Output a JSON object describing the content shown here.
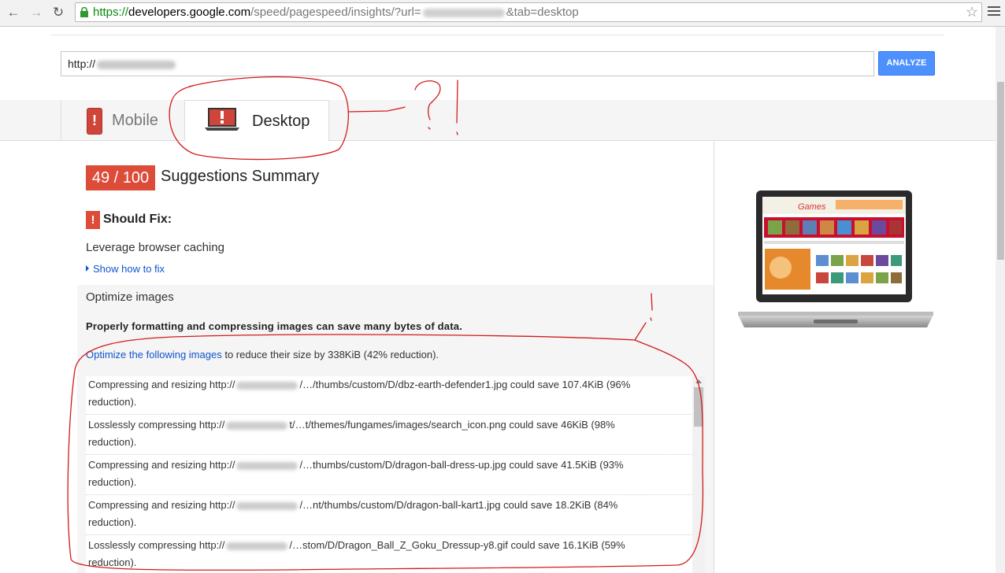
{
  "browser": {
    "url_scheme": "https://",
    "url_host": "developers.google.com",
    "url_path": "/speed/pagespeed/insights/?url=",
    "url_tail": "&tab=desktop",
    "icons": [
      "back-icon",
      "forward-icon",
      "reload-icon",
      "lock-icon",
      "star-icon",
      "menu-icon"
    ]
  },
  "form": {
    "url_value_prefix": "http://",
    "analyze_label": "ANALYZE"
  },
  "tabs": [
    {
      "label": "Mobile",
      "active": false
    },
    {
      "label": "Desktop",
      "active": true
    }
  ],
  "summary": {
    "score": "49 / 100",
    "title": "Suggestions Summary"
  },
  "should_fix": {
    "heading": "Should Fix:",
    "badge": "!",
    "rule1": "Leverage browser caching",
    "show_how": "Show how to fix",
    "rule2": "Optimize images",
    "rule2_desc": "Properly formatting and compressing images can save many bytes of data.",
    "intro_link": "Optimize the following images",
    "intro_rest": "to reduce their size by 338KiB (42% reduction)."
  },
  "images": [
    {
      "action": "Compressing and resizing http://",
      "path": "/…/thumbs/custom/D/dbz-earth-defender1.jpg could save 107.4KiB (96%",
      "tail": "reduction)."
    },
    {
      "action": "Losslessly compressing http://",
      "path": "t/…t/themes/fungames/images/search_icon.png could save 46KiB (98%",
      "tail": "reduction)."
    },
    {
      "action": "Compressing and resizing http://",
      "path": "/…thumbs/custom/D/dragon-ball-dress-up.jpg could save 41.5KiB (93%",
      "tail": "reduction)."
    },
    {
      "action": "Compressing and resizing http://",
      "path": "/…nt/thumbs/custom/D/dragon-ball-kart1.jpg could save 18.2KiB (84%",
      "tail": "reduction)."
    },
    {
      "action": "Losslessly compressing http://",
      "path": "/…stom/D/Dragon_Ball_Z_Goku_Dressup-y8.gif could save 16.1KiB (59%",
      "tail": "reduction)."
    }
  ],
  "preview": {
    "site_logo": "Games"
  },
  "annotations": {
    "color": "#d21b1b",
    "marks": "? !"
  },
  "colors": {
    "accent_blue": "#4d90fe",
    "score_red": "#dd4b39",
    "link": "#1155cc"
  }
}
